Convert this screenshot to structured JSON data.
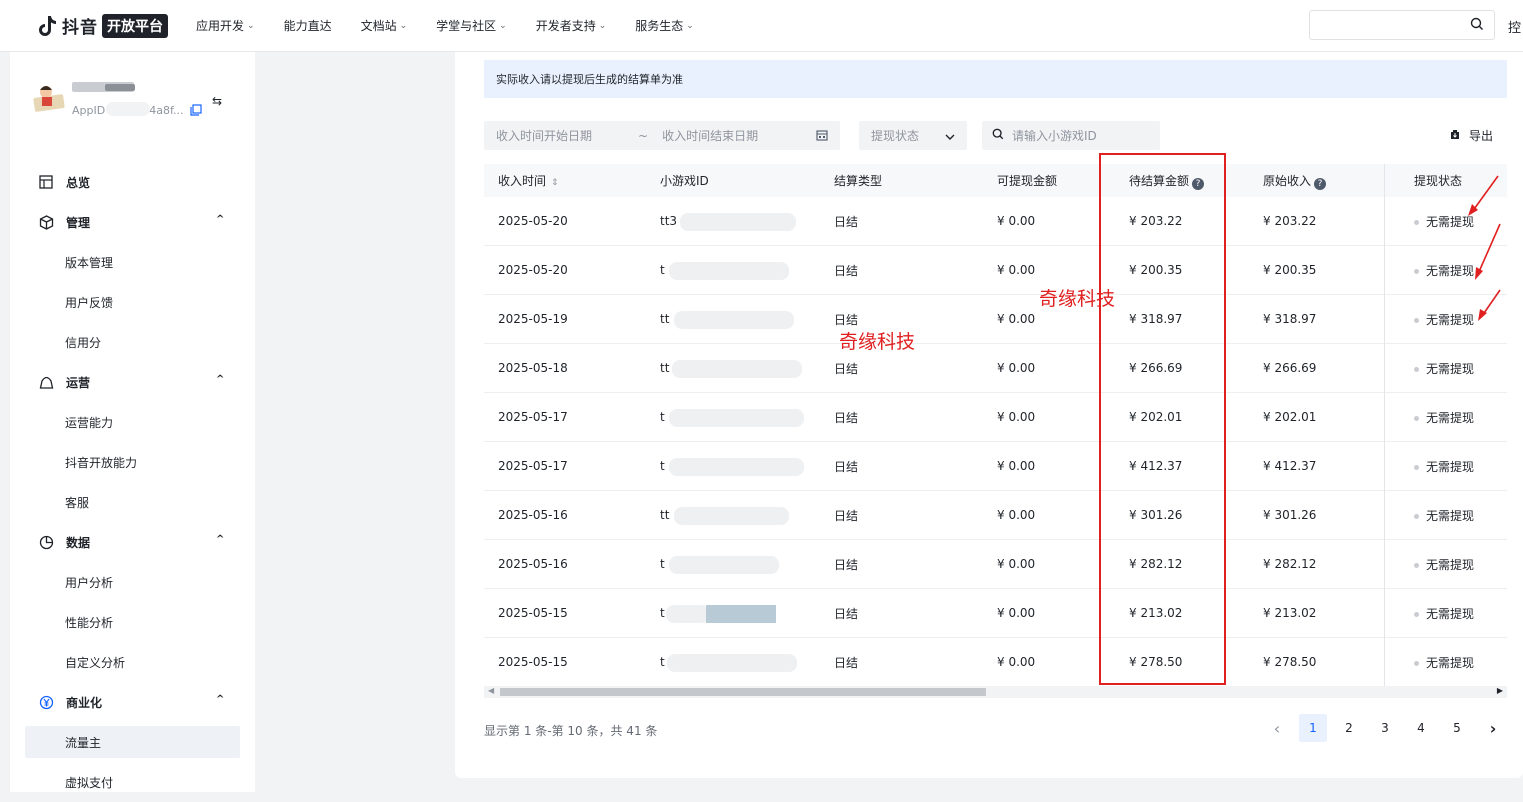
{
  "topbar": {
    "logo_text": "抖音",
    "logo_badge": "开放平台",
    "nav": [
      {
        "label": "应用开发",
        "has_dropdown": true
      },
      {
        "label": "能力直达",
        "has_dropdown": false
      },
      {
        "label": "文档站",
        "has_dropdown": true
      },
      {
        "label": "学堂与社区",
        "has_dropdown": true
      },
      {
        "label": "开发者支持",
        "has_dropdown": true
      },
      {
        "label": "服务生态",
        "has_dropdown": true
      }
    ],
    "search_placeholder": "",
    "right_cut_text": "控"
  },
  "sidebar": {
    "appid_prefix": "AppID",
    "appid_suffix": "4a8f...",
    "menu": {
      "overview": "总览",
      "manage": "管理",
      "manage_items": [
        "版本管理",
        "用户反馈",
        "信用分"
      ],
      "operate": "运营",
      "operate_items": [
        "运营能力",
        "抖音开放能力",
        "客服"
      ],
      "data": "数据",
      "data_items": [
        "用户分析",
        "性能分析",
        "自定义分析"
      ],
      "biz": "商业化",
      "biz_items": [
        "流量主",
        "虚拟支付"
      ]
    }
  },
  "main": {
    "notice": "实际收入请以提现后生成的结算单为准",
    "filters": {
      "start_placeholder": "收入时间开始日期",
      "tilde": "~",
      "end_placeholder": "收入时间结束日期",
      "status_placeholder": "提现状态",
      "game_placeholder": "请输入小游戏ID",
      "export_label": "导出"
    },
    "table": {
      "headers": [
        "收入时间",
        "小游戏ID",
        "结算类型",
        "可提现金额",
        "待结算金额",
        "原始收入",
        "提现状态"
      ],
      "rows": [
        {
          "date": "2025-05-20",
          "id": "tt3",
          "type": "日结",
          "withdrawable": "¥ 0.00",
          "pending": "¥ 203.22",
          "original": "¥ 203.22",
          "status": "无需提现"
        },
        {
          "date": "2025-05-20",
          "id": "t",
          "type": "日结",
          "withdrawable": "¥ 0.00",
          "pending": "¥ 200.35",
          "original": "¥ 200.35",
          "status": "无需提现"
        },
        {
          "date": "2025-05-19",
          "id": "tt",
          "type": "日结",
          "withdrawable": "¥ 0.00",
          "pending": "¥ 318.97",
          "original": "¥ 318.97",
          "status": "无需提现"
        },
        {
          "date": "2025-05-18",
          "id": "tt",
          "type": "日结",
          "withdrawable": "¥ 0.00",
          "pending": "¥ 266.69",
          "original": "¥ 266.69",
          "status": "无需提现"
        },
        {
          "date": "2025-05-17",
          "id": "t",
          "type": "日结",
          "withdrawable": "¥ 0.00",
          "pending": "¥ 202.01",
          "original": "¥ 202.01",
          "status": "无需提现"
        },
        {
          "date": "2025-05-17",
          "id": "t",
          "type": "日结",
          "withdrawable": "¥ 0.00",
          "pending": "¥ 412.37",
          "original": "¥ 412.37",
          "status": "无需提现"
        },
        {
          "date": "2025-05-16",
          "id": "tt",
          "type": "日结",
          "withdrawable": "¥ 0.00",
          "pending": "¥ 301.26",
          "original": "¥ 301.26",
          "status": "无需提现"
        },
        {
          "date": "2025-05-16",
          "id": "t",
          "type": "日结",
          "withdrawable": "¥ 0.00",
          "pending": "¥ 282.12",
          "original": "¥ 282.12",
          "status": "无需提现"
        },
        {
          "date": "2025-05-15",
          "id": "t",
          "type": "日结",
          "withdrawable": "¥ 0.00",
          "pending": "¥ 213.02",
          "original": "¥ 213.02",
          "status": "无需提现"
        },
        {
          "date": "2025-05-15",
          "id": "t",
          "type": "日结",
          "withdrawable": "¥ 0.00",
          "pending": "¥ 278.50",
          "original": "¥ 278.50",
          "status": "无需提现"
        }
      ]
    },
    "pagination": {
      "info": "显示第 1 条-第 10 条，共 41 条",
      "pages": [
        "1",
        "2",
        "3",
        "4",
        "5"
      ],
      "current": "1"
    }
  },
  "annotations": {
    "watermark": "奇缘科技",
    "color": "#e02020"
  }
}
